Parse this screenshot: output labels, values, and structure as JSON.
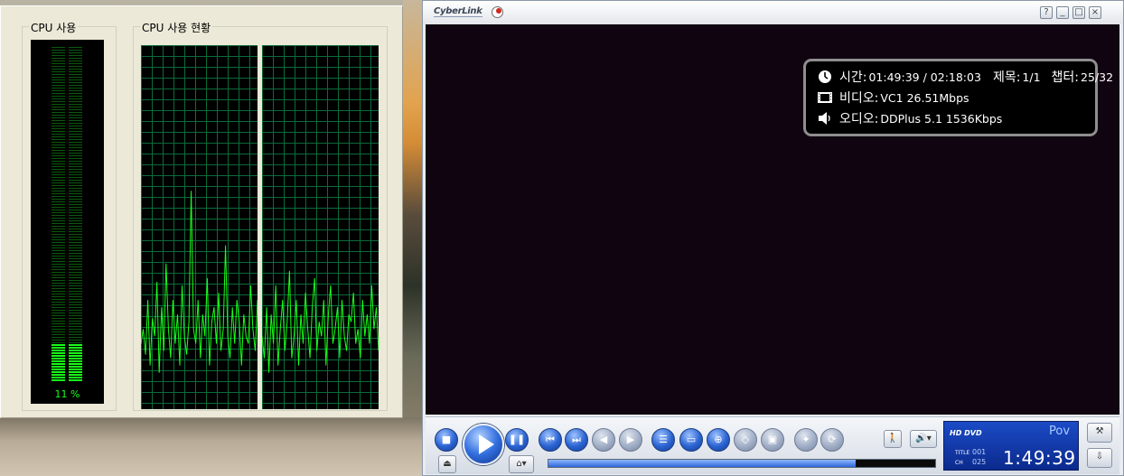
{
  "task_manager": {
    "cpu_usage_title": "CPU 사용",
    "cpu_history_title": "CPU 사용 현황",
    "cpu_percent_text": "11 %",
    "cpu_usage_fraction": 0.11,
    "graph_color": "#18ff18",
    "grid_color": "#0b6b3a",
    "history_core1": [
      18,
      22,
      15,
      30,
      12,
      25,
      20,
      35,
      10,
      28,
      16,
      40,
      22,
      14,
      30,
      18,
      26,
      12,
      34,
      20,
      15,
      24,
      60,
      22,
      18,
      30,
      14,
      26,
      20,
      36,
      12,
      24,
      28,
      18,
      32,
      16,
      22,
      45,
      20,
      14,
      28,
      18,
      30,
      24,
      12,
      26,
      20,
      18,
      34,
      22,
      16,
      30
    ],
    "history_core2": [
      20,
      14,
      28,
      10,
      26,
      18,
      34,
      12,
      22,
      30,
      16,
      24,
      38,
      14,
      20,
      30,
      12,
      26,
      18,
      32,
      22,
      14,
      28,
      36,
      16,
      24,
      20,
      30,
      12,
      26,
      34,
      18,
      22,
      28,
      14,
      30,
      20,
      16,
      26,
      24,
      32,
      18,
      22,
      14,
      30,
      20,
      26,
      18,
      34,
      22,
      28,
      16
    ]
  },
  "player": {
    "brand": "CyberLink",
    "title_buttons": [
      "?",
      "_",
      "□",
      "×"
    ],
    "osd": {
      "time_label": "시간:",
      "time_value": "01:49:39 / 02:18:03",
      "title_label": "제목:",
      "title_value": "1/1",
      "chapter_label": "챕터:",
      "chapter_value": "25/32",
      "video_label": "비디오:",
      "video_value": "VC1  26.51Mbps",
      "audio_label": "오디오:",
      "audio_value": "DDPlus 5.1  1536Kbps"
    },
    "controls": {
      "playback_progress": 0.795
    },
    "lcd": {
      "logo_line1": "HD DVD",
      "scroll_text": "Pov",
      "title_label": "TITLE",
      "title_value": "001",
      "ch_label": "CH",
      "ch_value": "025",
      "time": "1:49:39"
    }
  }
}
